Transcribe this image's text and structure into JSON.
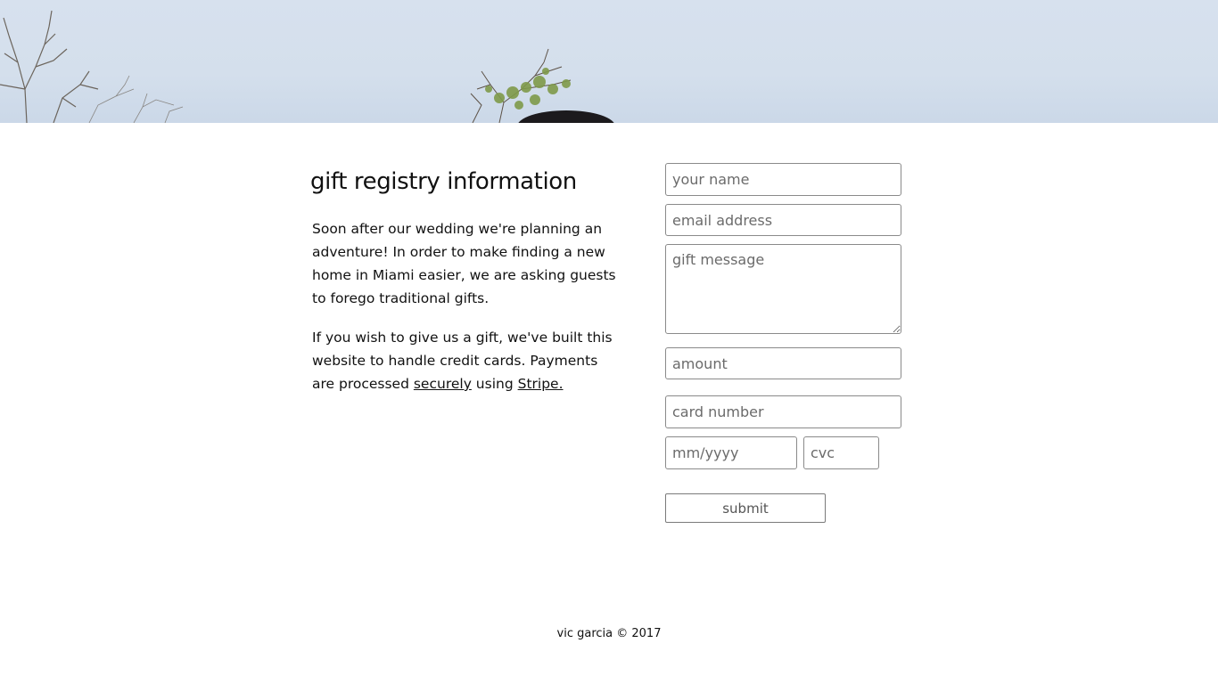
{
  "hero": {
    "image": "sky-with-trees-photo"
  },
  "info": {
    "title": "gift registry information",
    "paragraph1": "Soon after our wedding we're planning an adventure! In order to make finding a new home in Miami easier, we are asking guests to forego traditional gifts.",
    "paragraph2_before": "If you wish to give us a gift, we've built this website to handle credit cards. Payments are processed ",
    "link_securely": "securely",
    "paragraph2_middle": " using ",
    "link_stripe": "Stripe.",
    "link_color": "#111111"
  },
  "form": {
    "name_placeholder": "your name",
    "name_value": "",
    "email_placeholder": "email address",
    "email_value": "",
    "message_placeholder": "gift message",
    "message_value": "",
    "amount_placeholder": "amount",
    "amount_value": "",
    "card_placeholder": "card number",
    "card_value": "",
    "expiry_placeholder": "mm/yyyy",
    "expiry_value": "",
    "cvc_placeholder": "cvc",
    "cvc_value": "",
    "submit_label": "submit"
  },
  "footer": {
    "text": "vic garcia © 2017"
  },
  "colors": {
    "background": "#ffffff",
    "text": "#111111",
    "border": "#8a8a8a",
    "sky": "#d4dfec"
  }
}
